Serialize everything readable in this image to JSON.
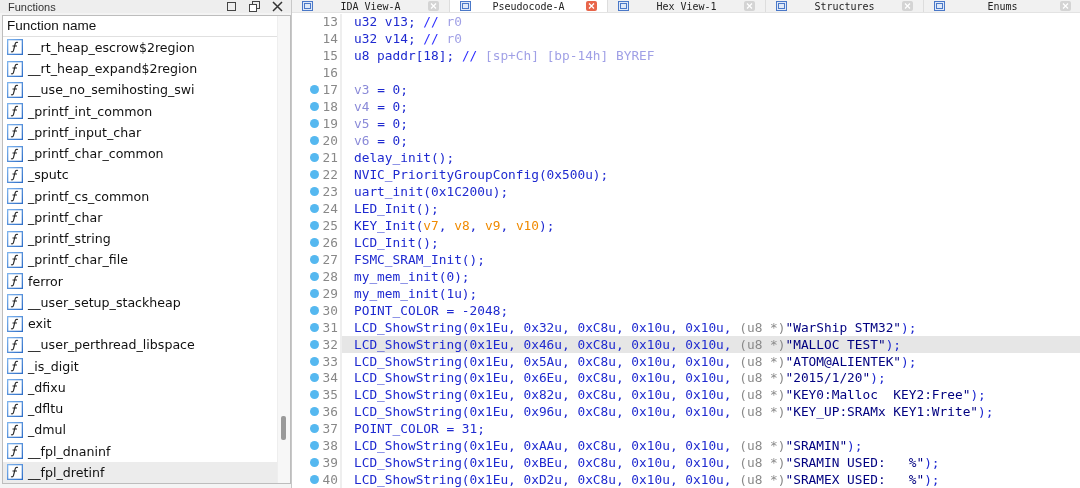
{
  "functions_panel": {
    "title": "Functions",
    "column": "Function name",
    "items": [
      {
        "name": "__rt_heap_escrow$2region",
        "selected": false
      },
      {
        "name": "__rt_heap_expand$2region",
        "selected": false
      },
      {
        "name": "__use_no_semihosting_swi",
        "selected": false
      },
      {
        "name": "_printf_int_common",
        "selected": false
      },
      {
        "name": "_printf_input_char",
        "selected": false
      },
      {
        "name": "_printf_char_common",
        "selected": false
      },
      {
        "name": "_sputc",
        "selected": false
      },
      {
        "name": "_printf_cs_common",
        "selected": false
      },
      {
        "name": "_printf_char",
        "selected": false
      },
      {
        "name": "_printf_string",
        "selected": false
      },
      {
        "name": "_printf_char_file",
        "selected": false
      },
      {
        "name": "ferror",
        "selected": false
      },
      {
        "name": "__user_setup_stackheap",
        "selected": false
      },
      {
        "name": "exit",
        "selected": false
      },
      {
        "name": "__user_perthread_libspace",
        "selected": false
      },
      {
        "name": "_is_digit",
        "selected": false
      },
      {
        "name": "_dfixu",
        "selected": false
      },
      {
        "name": "_dfltu",
        "selected": false
      },
      {
        "name": "_dmul",
        "selected": false
      },
      {
        "name": "__fpl_dnaninf",
        "selected": false
      },
      {
        "name": "__fpl_dretinf",
        "selected": true
      }
    ]
  },
  "tabs": [
    {
      "label": "IDA View-A",
      "selected": false
    },
    {
      "label": "Pseudocode-A",
      "selected": true
    },
    {
      "label": "Hex View-1",
      "selected": false
    },
    {
      "label": "Structures",
      "selected": false
    },
    {
      "label": "Enums",
      "selected": false
    }
  ],
  "code": {
    "lines": [
      {
        "number": "13",
        "marker": false,
        "selected": false,
        "tokens": [
          {
            "kind": "plain",
            "text": "u32 v13; "
          },
          {
            "kind": "comment",
            "text": "// "
          },
          {
            "kind": "note",
            "text": "r0"
          }
        ]
      },
      {
        "number": "14",
        "marker": false,
        "selected": false,
        "tokens": [
          {
            "kind": "plain",
            "text": "u32 v14; "
          },
          {
            "kind": "comment",
            "text": "// "
          },
          {
            "kind": "note",
            "text": "r0"
          }
        ]
      },
      {
        "number": "15",
        "marker": false,
        "selected": false,
        "tokens": [
          {
            "kind": "plain",
            "text": "u8 paddr[18]; "
          },
          {
            "kind": "comment",
            "text": "// "
          },
          {
            "kind": "note",
            "text": "[sp+Ch] [bp-14h] BYREF"
          }
        ]
      },
      {
        "number": "16",
        "marker": false,
        "selected": false
      },
      {
        "number": "17",
        "marker": true,
        "selected": false,
        "tokens": [
          {
            "kind": "var",
            "text": "v3"
          },
          {
            "kind": "plain",
            "text": " = 0;"
          }
        ]
      },
      {
        "number": "18",
        "marker": true,
        "selected": false,
        "tokens": [
          {
            "kind": "var",
            "text": "v4"
          },
          {
            "kind": "plain",
            "text": " = 0;"
          }
        ]
      },
      {
        "number": "19",
        "marker": true,
        "selected": false,
        "tokens": [
          {
            "kind": "var",
            "text": "v5"
          },
          {
            "kind": "plain",
            "text": " = 0;"
          }
        ]
      },
      {
        "number": "20",
        "marker": true,
        "selected": false,
        "tokens": [
          {
            "kind": "var",
            "text": "v6"
          },
          {
            "kind": "plain",
            "text": " = 0;"
          }
        ]
      },
      {
        "number": "21",
        "marker": true,
        "selected": false,
        "tokens": [
          {
            "kind": "plain",
            "text": "delay_init();"
          }
        ]
      },
      {
        "number": "22",
        "marker": true,
        "selected": false,
        "tokens": [
          {
            "kind": "plain",
            "text": "NVIC_PriorityGroupConfig(0x500u);"
          }
        ]
      },
      {
        "number": "23",
        "marker": true,
        "selected": false,
        "tokens": [
          {
            "kind": "plain",
            "text": "uart_init(0x1C200u);"
          }
        ]
      },
      {
        "number": "24",
        "marker": true,
        "selected": false,
        "tokens": [
          {
            "kind": "plain",
            "text": "LED_Init();"
          }
        ]
      },
      {
        "number": "25",
        "marker": true,
        "selected": false,
        "tokens": [
          {
            "kind": "plain",
            "text": "KEY_Init("
          },
          {
            "kind": "arg",
            "text": "v7"
          },
          {
            "kind": "plain",
            "text": ", "
          },
          {
            "kind": "arg",
            "text": "v8"
          },
          {
            "kind": "plain",
            "text": ", "
          },
          {
            "kind": "arg",
            "text": "v9"
          },
          {
            "kind": "plain",
            "text": ", "
          },
          {
            "kind": "arg",
            "text": "v10"
          },
          {
            "kind": "plain",
            "text": ");"
          }
        ]
      },
      {
        "number": "26",
        "marker": true,
        "selected": false,
        "tokens": [
          {
            "kind": "plain",
            "text": "LCD_Init();"
          }
        ]
      },
      {
        "number": "27",
        "marker": true,
        "selected": false,
        "tokens": [
          {
            "kind": "plain",
            "text": "FSMC_SRAM_Init();"
          }
        ]
      },
      {
        "number": "28",
        "marker": true,
        "selected": false,
        "tokens": [
          {
            "kind": "plain",
            "text": "my_mem_init(0);"
          }
        ]
      },
      {
        "number": "29",
        "marker": true,
        "selected": false,
        "tokens": [
          {
            "kind": "plain",
            "text": "my_mem_init(1u);"
          }
        ]
      },
      {
        "number": "30",
        "marker": true,
        "selected": false,
        "tokens": [
          {
            "kind": "plain",
            "text": "POINT_COLOR = -2048;"
          }
        ]
      },
      {
        "number": "31",
        "marker": true,
        "selected": false,
        "tokens": [
          {
            "kind": "plain",
            "text": "LCD_ShowString(0x1Eu, 0x32u, 0xC8u, 0x10u, 0x10u, "
          },
          {
            "kind": "cast",
            "text": "(u8 *)"
          },
          {
            "kind": "string",
            "text": "\"WarShip STM32\""
          },
          {
            "kind": "plain",
            "text": ");"
          }
        ]
      },
      {
        "number": "32",
        "marker": true,
        "selected": true,
        "tokens": [
          {
            "kind": "plain",
            "text": "LCD_ShowString(0x1Eu, 0x46u, 0xC8u, 0x10u, 0x10u, "
          },
          {
            "kind": "cast",
            "text": "(u8 *)"
          },
          {
            "kind": "string",
            "text": "\"MALLOC TEST\""
          },
          {
            "kind": "plain",
            "text": ");"
          }
        ]
      },
      {
        "number": "33",
        "marker": true,
        "selected": false,
        "tokens": [
          {
            "kind": "plain",
            "text": "LCD_ShowString(0x1Eu, 0x5Au, 0xC8u, 0x10u, 0x10u, "
          },
          {
            "kind": "cast",
            "text": "(u8 *)"
          },
          {
            "kind": "string",
            "text": "\"ATOM@ALIENTEK\""
          },
          {
            "kind": "plain",
            "text": ");"
          }
        ]
      },
      {
        "number": "34",
        "marker": true,
        "selected": false,
        "tokens": [
          {
            "kind": "plain",
            "text": "LCD_ShowString(0x1Eu, 0x6Eu, 0xC8u, 0x10u, 0x10u, "
          },
          {
            "kind": "cast",
            "text": "(u8 *)"
          },
          {
            "kind": "string",
            "text": "\"2015/1/20\""
          },
          {
            "kind": "plain",
            "text": ");"
          }
        ]
      },
      {
        "number": "35",
        "marker": true,
        "selected": false,
        "tokens": [
          {
            "kind": "plain",
            "text": "LCD_ShowString(0x1Eu, 0x82u, 0xC8u, 0x10u, 0x10u, "
          },
          {
            "kind": "cast",
            "text": "(u8 *)"
          },
          {
            "kind": "string",
            "text": "\"KEY0:Malloc  KEY2:Free\""
          },
          {
            "kind": "plain",
            "text": ");"
          }
        ]
      },
      {
        "number": "36",
        "marker": true,
        "selected": false,
        "tokens": [
          {
            "kind": "plain",
            "text": "LCD_ShowString(0x1Eu, 0x96u, 0xC8u, 0x10u, 0x10u, "
          },
          {
            "kind": "cast",
            "text": "(u8 *)"
          },
          {
            "kind": "string",
            "text": "\"KEY_UP:SRAMx KEY1:Write\""
          },
          {
            "kind": "plain",
            "text": ");"
          }
        ]
      },
      {
        "number": "37",
        "marker": true,
        "selected": false,
        "tokens": [
          {
            "kind": "plain",
            "text": "POINT_COLOR = 31;"
          }
        ]
      },
      {
        "number": "38",
        "marker": true,
        "selected": false,
        "tokens": [
          {
            "kind": "plain",
            "text": "LCD_ShowString(0x1Eu, 0xAAu, 0xC8u, 0x10u, 0x10u, "
          },
          {
            "kind": "cast",
            "text": "(u8 *)"
          },
          {
            "kind": "string",
            "text": "\"SRAMIN\""
          },
          {
            "kind": "plain",
            "text": ");"
          }
        ]
      },
      {
        "number": "39",
        "marker": true,
        "selected": false,
        "tokens": [
          {
            "kind": "plain",
            "text": "LCD_ShowString(0x1Eu, 0xBEu, 0xC8u, 0x10u, 0x10u, "
          },
          {
            "kind": "cast",
            "text": "(u8 *)"
          },
          {
            "kind": "string",
            "text": "\"SRAMIN USED:   %\""
          },
          {
            "kind": "plain",
            "text": ");"
          }
        ]
      },
      {
        "number": "40",
        "marker": true,
        "selected": false,
        "tokens": [
          {
            "kind": "plain",
            "text": "LCD_ShowString(0x1Eu, 0xD2u, 0xC8u, 0x10u, 0x10u, "
          },
          {
            "kind": "cast",
            "text": "(u8 *)"
          },
          {
            "kind": "string",
            "text": "\"SRAMEX USED:   %\""
          },
          {
            "kind": "plain",
            "text": ");"
          }
        ]
      }
    ]
  }
}
